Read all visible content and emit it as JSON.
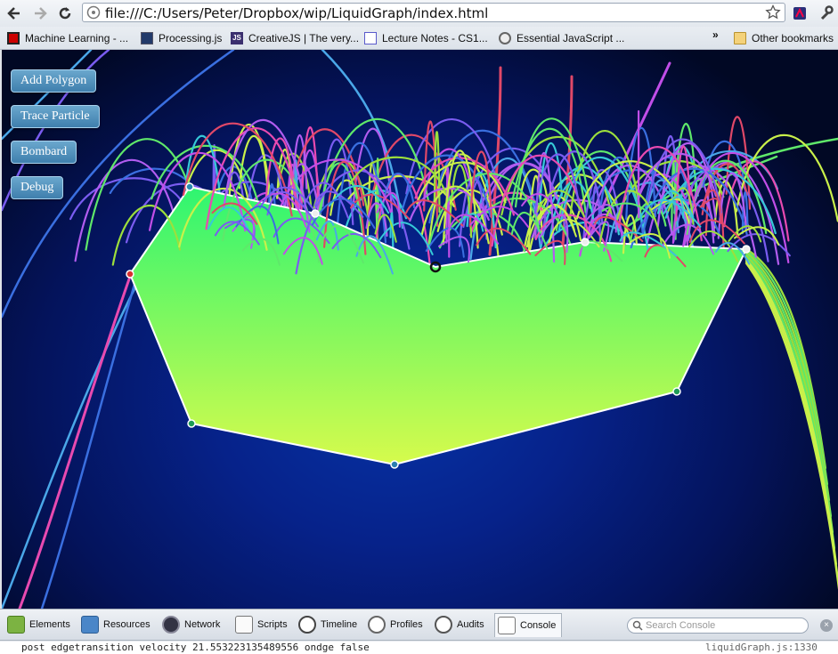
{
  "browser": {
    "url": "file:///C:/Users/Peter/Dropbox/wip/LiquidGraph/index.html",
    "bookmarks": [
      "Machine Learning - ...",
      "Processing.js",
      "CreativeJS | The very...",
      "Lecture Notes - CS1...",
      "Essential JavaScript ..."
    ],
    "overflow": "»",
    "other_bookmarks": "Other bookmarks"
  },
  "app": {
    "buttons": [
      "Add Polygon",
      "Trace Particle",
      "Bombard",
      "Debug"
    ]
  },
  "devtools": {
    "tabs": [
      "Elements",
      "Resources",
      "Network",
      "Scripts",
      "Timeline",
      "Profiles",
      "Audits",
      "Console"
    ],
    "active_tab": "Console",
    "search_placeholder": "Search Console",
    "console_message": "post edgetransition velocity 21.553223135489556 ondge false",
    "console_source": "liquidGraph.js:1330"
  },
  "colors": {
    "polygon_top": "#2ef571",
    "polygon_bottom": "#d6fb4c",
    "button_fill": "#4f8fbd",
    "background_center": "#0733a6"
  }
}
